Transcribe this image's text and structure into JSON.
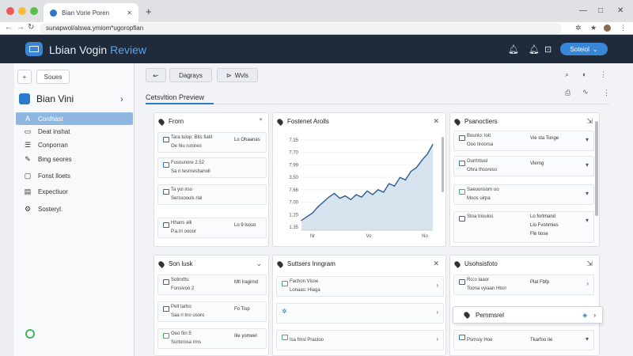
{
  "browser": {
    "tab_title": "Bian Vorie Poren",
    "tab_close": "✕",
    "new_tab": "+",
    "url": "sunapwol/alswa.ymiom*ugoropfian",
    "window_controls": [
      "—",
      "□",
      "✕"
    ]
  },
  "header": {
    "title_main": "Lbian Vogin ",
    "title_sub": "Review",
    "select_label": "Soteiol",
    "colors": {
      "bar": "#1f2a3a",
      "accent": "#3a86d6"
    }
  },
  "sidebar": {
    "add_label": "+",
    "btn_label": "Soues",
    "brand": "Bian Vini",
    "items": [
      {
        "label": "Conlhast",
        "icon": "a-icon",
        "active": true
      },
      {
        "label": "Deat inshat",
        "icon": "doc-icon",
        "active": false
      },
      {
        "label": "Conporran",
        "icon": "list-icon",
        "active": false
      },
      {
        "label": "Bmg seores",
        "icon": "pen-icon",
        "active": false
      },
      {
        "label": "Fonst lloets",
        "icon": "square-icon",
        "active": false
      },
      {
        "label": "Expectiuor",
        "icon": "folder-icon",
        "active": false
      },
      {
        "label": "Sosteryl.",
        "icon": "gear-icon",
        "active": false
      }
    ]
  },
  "toolbar": {
    "btn1": "↜",
    "btn2": "Dagrays",
    "btn3": "Wvls",
    "preview_title": "Cetsvltion Preview"
  },
  "panels": {
    "p1": {
      "title": "Frorn",
      "rows": [
        {
          "l1": "Tara tulop: Bits fiatil",
          "l2": "Oe hiu ruroreo",
          "r": "Lo Ohaanas"
        },
        {
          "l1": "Fusounore 2.52",
          "l2": "Sa ri tesrneshanoll",
          "r": ""
        },
        {
          "l1": "Ta yoi irso",
          "l2": "Serssoouls rlal",
          "r": ""
        },
        {
          "l1": "Hhans alli",
          "l2": "P.a.tri oooor",
          "r": "Lo 9 lsoso"
        }
      ]
    },
    "p2": {
      "title": "Fostenet Arolls",
      "chart_data": {
        "type": "line",
        "x": [
          0,
          1,
          2,
          3,
          4,
          5,
          6,
          7,
          8,
          9,
          10,
          11,
          12,
          13,
          14,
          15,
          16,
          17,
          18,
          19,
          20,
          21,
          22,
          23,
          24
        ],
        "values": [
          8,
          11,
          14,
          19,
          23,
          27,
          30,
          26,
          28,
          25,
          29,
          27,
          32,
          29,
          33,
          31,
          38,
          36,
          43,
          41,
          48,
          51,
          57,
          62,
          70
        ],
        "ylim": [
          0,
          80
        ],
        "ytick_labels": [
          "7.35",
          "7.70",
          "7.99",
          "3.50",
          "7.66",
          "7.00",
          "1.20",
          "1.35"
        ],
        "xtick_labels": [
          "Nr",
          "Vo",
          "No"
        ],
        "area_fill": true,
        "colors": {
          "line": "#2c5d8f",
          "area": "#d7e3ef"
        }
      }
    },
    "p3": {
      "title": "Psanoctiers",
      "rows": [
        {
          "l1": "Bounlo: Iolt",
          "l2": "Ooo tiroorsa",
          "r": "Vie sta Tonge"
        },
        {
          "l1": "Gurrtrtiusl",
          "l2": "Ohra thsoreso",
          "r": "Vlerng"
        },
        {
          "l1": "Saeuonsorn uo",
          "l2": "Moos uirpa",
          "r": ""
        },
        {
          "l1": "Stoa trioulos",
          "l2": "",
          "r": "Lo fortmand"
        }
      ],
      "rows_r2": [
        "Llo Fvonmies",
        "Fle tiose"
      ]
    },
    "p4": {
      "title": "Son lusk",
      "rows": [
        {
          "l1": "Sotinrtts:",
          "l2": "Fonsivoo 2",
          "r": "Mlt Iragirnd"
        },
        {
          "l1": "Pelt tarbo",
          "l2": "Saa ri tno usoro",
          "r": "Fo Tisp"
        },
        {
          "l1": "Oeo fiin 5",
          "l2": "Surtorosa rrns",
          "r": "Iile yomeel"
        }
      ]
    },
    "p5": {
      "title": "Suttsers Inngram",
      "rows": [
        {
          "l1": "Fachon Visse",
          "l2": "Lonaas: Hiaga",
          "r": ""
        },
        {
          "l1": "",
          "l2": "",
          "r": ""
        },
        {
          "l1": "Isa fmsl Prastoo",
          "l2": "",
          "r": ""
        }
      ]
    },
    "p6": {
      "title": "Usohsisfoto",
      "rows": [
        {
          "l1": "Ro:o Iaaor",
          "l2": "Toona vyiaan Htorr",
          "r": "Plat Fbfp"
        },
        {
          "l1": "Psrnsiy Hoe",
          "l2": "",
          "r": "Tkarfoo Iie"
        }
      ]
    },
    "popup": {
      "label": "Pemmsrel"
    }
  }
}
